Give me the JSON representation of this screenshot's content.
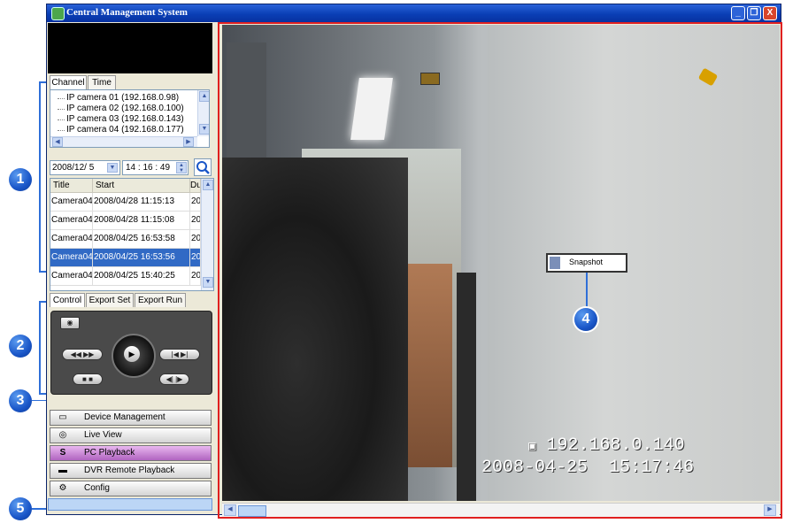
{
  "window": {
    "title": "Central Management System",
    "min": "_",
    "max": "❐",
    "close": "X"
  },
  "channel_panel": {
    "tabs": [
      "Channel",
      "Time"
    ],
    "cameras": [
      "IP camera 01 (192.168.0.98)",
      "IP camera 02 (192.168.0.100)",
      "IP camera 03 (192.168.0.143)",
      "IP camera 04 (192.168.0.177)"
    ]
  },
  "search": {
    "date": "2008/12/ 5",
    "time": "14 : 16 : 49"
  },
  "recordings": {
    "columns": [
      "Title",
      "Start",
      "Du"
    ],
    "rows": [
      {
        "title": "Camera04",
        "start": "2008/04/28 11:15:13",
        "du": "20"
      },
      {
        "title": "Camera04",
        "start": "2008/04/28 11:15:08",
        "du": "20"
      },
      {
        "title": "Camera04",
        "start": "2008/04/25 16:53:58",
        "du": "20"
      },
      {
        "title": "Camera04",
        "start": "2008/04/25 16:53:56",
        "du": "20",
        "selected": true
      },
      {
        "title": "Camera04",
        "start": "2008/04/25 15:40:25",
        "du": "20"
      }
    ]
  },
  "control_tabs": [
    "Control",
    "Export Set",
    "Export Run"
  ],
  "menu": [
    {
      "label": "Device Management",
      "icon": "device-icon"
    },
    {
      "label": "Live View",
      "icon": "eye-icon"
    },
    {
      "label": "PC Playback",
      "icon": "playback-icon"
    },
    {
      "label": "DVR Remote Playback",
      "icon": "dvr-icon"
    },
    {
      "label": "Config",
      "icon": "config-icon"
    }
  ],
  "video": {
    "ip_overlay": "192.168.0.140",
    "timestamp_overlay": "2008-04-25  15:17:46",
    "context_menu": {
      "item": "Snapshot"
    }
  },
  "callouts": [
    "1",
    "2",
    "3",
    "4",
    "5"
  ],
  "colors": {
    "accent": "#2f6fd8",
    "highlight_frame": "#e02020",
    "selected_row": "#316ac5"
  }
}
